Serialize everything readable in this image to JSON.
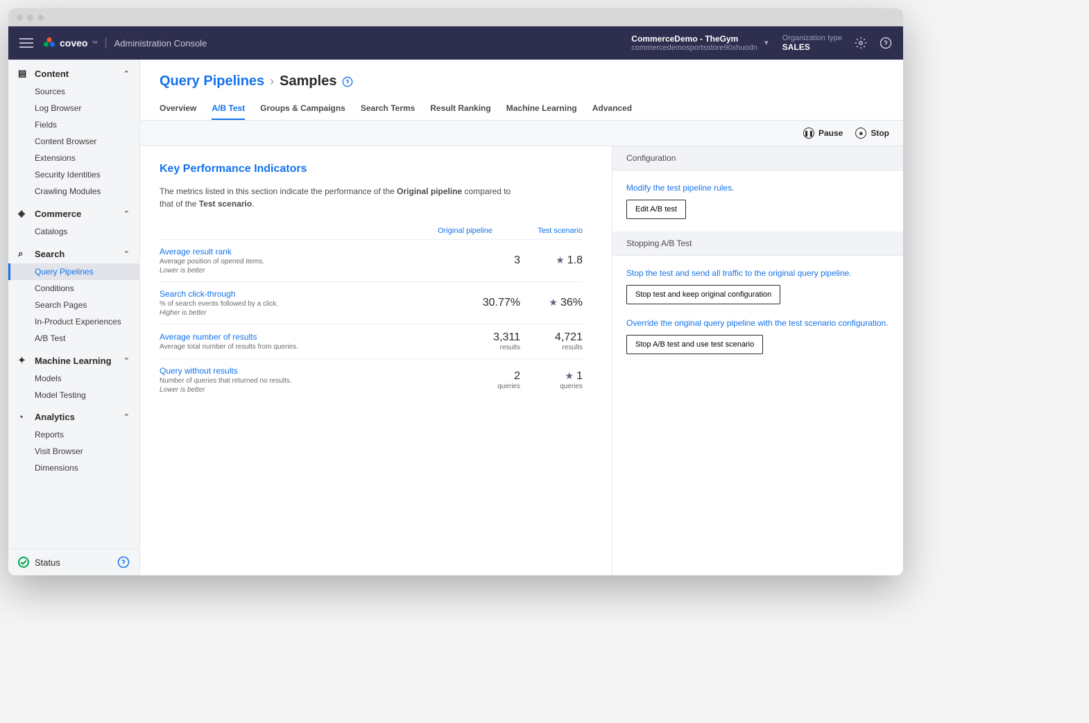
{
  "header": {
    "brand": "coveo",
    "console": "Administration Console",
    "org_name": "CommerceDemo - TheGym",
    "org_id": "commercedemosportsstore90xhuodn",
    "org_type_label": "Organization type",
    "org_type": "SALES"
  },
  "sidebar": {
    "sections": [
      {
        "title": "Content",
        "items": [
          "Sources",
          "Log Browser",
          "Fields",
          "Content Browser",
          "Extensions",
          "Security Identities",
          "Crawling Modules"
        ]
      },
      {
        "title": "Commerce",
        "items": [
          "Catalogs"
        ]
      },
      {
        "title": "Search",
        "items": [
          "Query Pipelines",
          "Conditions",
          "Search Pages",
          "In-Product Experiences",
          "A/B Test"
        ],
        "active": 0
      },
      {
        "title": "Machine Learning",
        "items": [
          "Models",
          "Model Testing"
        ]
      },
      {
        "title": "Analytics",
        "items": [
          "Reports",
          "Visit Browser",
          "Dimensions"
        ]
      }
    ],
    "status": "Status"
  },
  "breadcrumb": {
    "parent": "Query Pipelines",
    "current": "Samples"
  },
  "tabs": [
    "Overview",
    "A/B Test",
    "Groups & Campaigns",
    "Search Terms",
    "Result Ranking",
    "Machine Learning",
    "Advanced"
  ],
  "activeTab": 1,
  "actions": {
    "pause": "Pause",
    "stop": "Stop"
  },
  "kpi": {
    "title": "Key Performance Indicators",
    "desc_pre": "The metrics listed in this section indicate the performance of the ",
    "desc_b1": "Original pipeline",
    "desc_mid": " compared to that of the ",
    "desc_b2": "Test scenario",
    "desc_end": ".",
    "col1": "Original pipeline",
    "col2": "Test scenario",
    "rows": [
      {
        "name": "Average result rank",
        "sub": "Average position of opened items.",
        "note": "Lower is better",
        "v1": "3",
        "u1": "",
        "v2": "1.8",
        "u2": "",
        "star": true
      },
      {
        "name": "Search click-through",
        "sub": "% of search events followed by a click.",
        "note": "Higher is better",
        "v1": "30.77%",
        "u1": "",
        "v2": "36%",
        "u2": "",
        "star": true
      },
      {
        "name": "Average number of results",
        "sub": "Average total number of results from queries.",
        "note": "",
        "v1": "3,311",
        "u1": "results",
        "v2": "4,721",
        "u2": "results",
        "star": false
      },
      {
        "name": "Query without results",
        "sub": "Number of queries that returned no results.",
        "note": "Lower is better",
        "v1": "2",
        "u1": "queries",
        "v2": "1",
        "u2": "queries",
        "star": true
      }
    ]
  },
  "config": {
    "title": "Configuration",
    "modify": "Modify the test pipeline rules.",
    "edit_btn": "Edit A/B test"
  },
  "stopping": {
    "title": "Stopping A/B Test",
    "txt1": "Stop the test and send all traffic to the original query pipeline.",
    "btn1": "Stop test and keep original configuration",
    "txt2": "Override the original query pipeline with the test scenario configuration.",
    "btn2": "Stop A/B test and use test scenario"
  }
}
